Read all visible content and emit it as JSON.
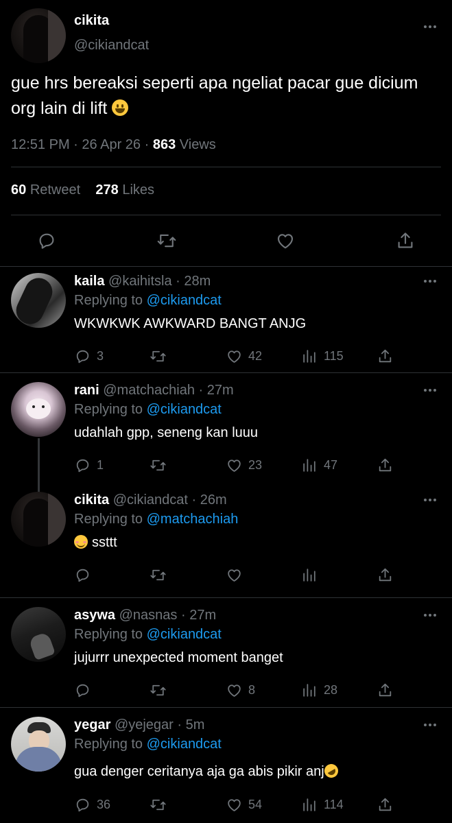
{
  "main_tweet": {
    "name": "cikita",
    "handle": "@cikiandcat",
    "text": "gue hrs bereaksi seperti apa ngeliat pacar gue dicium org lain di lift",
    "time": "12:51 PM",
    "date": "26 Apr 26",
    "views_count": "863",
    "views_label": "Views",
    "retweet_count": "60",
    "retweet_label": "Retweet",
    "likes_count": "278",
    "likes_label": "Likes"
  },
  "replies": [
    {
      "name": "kaila",
      "handle": "@kaihitsla",
      "time": "28m",
      "replying_prefix": "Replying to",
      "replying_to": "@cikiandcat",
      "text": "WKWKWK AWKWARD BANGT ANJG",
      "replies": "3",
      "retweets": "",
      "likes": "42",
      "views": "115"
    },
    {
      "name": "rani",
      "handle": "@matchachiah",
      "time": "27m",
      "replying_prefix": "Replying to",
      "replying_to": "@cikiandcat",
      "text": "udahlah gpp, seneng kan luuu",
      "replies": "1",
      "retweets": "",
      "likes": "23",
      "views": "47"
    },
    {
      "name": "cikita",
      "handle": "@cikiandcat",
      "time": "26m",
      "replying_prefix": "Replying to",
      "replying_to": "@matchachiah",
      "text": "ssttt",
      "replies": "",
      "retweets": "",
      "likes": "",
      "views": ""
    },
    {
      "name": "asywa",
      "handle": "@nasnas",
      "time": "27m",
      "replying_prefix": "Replying to",
      "replying_to": "@cikiandcat",
      "text": "jujurrr unexpected moment banget",
      "replies": "",
      "retweets": "",
      "likes": "8",
      "views": "28"
    },
    {
      "name": "yegar",
      "handle": "@yejegar",
      "time": "5m",
      "replying_prefix": "Replying to",
      "replying_to": "@cikiandcat",
      "text": "gua denger ceritanya aja ga abis pikir anj",
      "replies": "36",
      "retweets": "",
      "likes": "54",
      "views": "114"
    }
  ],
  "separators": {
    "dot": "·"
  },
  "icons": {
    "reply": "reply-icon",
    "retweet": "retweet-icon",
    "like": "heart-icon",
    "views": "views-icon",
    "share": "share-icon",
    "more": "more-icon"
  },
  "colors": {
    "background": "#000000",
    "text": "#e7e9ea",
    "muted": "#71767b",
    "link": "#1d9bf0",
    "divider": "#2f3336"
  }
}
